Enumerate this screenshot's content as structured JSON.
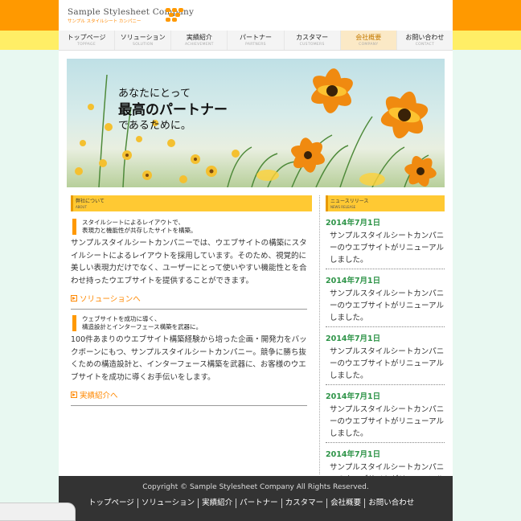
{
  "brand": {
    "title": "Sample Stylesheet Company",
    "subtitle": "サンプル スタイルシート カンパニー",
    "accent": "#ff9900",
    "news_green": "#2e9448",
    "footer_bg": "#333333"
  },
  "nav": [
    {
      "jp": "トップページ",
      "en": "TOPPAGE"
    },
    {
      "jp": "ソリューション",
      "en": "SOLUTION"
    },
    {
      "jp": "実績紹介",
      "en": "ACHIEVEMENT"
    },
    {
      "jp": "パートナー",
      "en": "PARTNERS"
    },
    {
      "jp": "カスタマー",
      "en": "CUSTOMERS"
    },
    {
      "jp": "会社概要",
      "en": "COMPANY"
    },
    {
      "jp": "お問い合わせ",
      "en": "CONTACT"
    }
  ],
  "hero": {
    "line1": "あなたにとって",
    "line2": "最高のパートナー",
    "line3": "であるために。"
  },
  "about": {
    "heading_jp": "弊社について",
    "heading_en": "ABOUT",
    "block1": {
      "lead1": "スタイルシートによるレイアウトで、",
      "lead2": "表現力と機能性が共存したサイトを構築。",
      "body": "サンプルスタイルシートカンパニーでは、ウエブサイトの構築にスタイルシートによるレイアウトを採用しています。そのため、視覚的に美しい表現力だけでなく、ユーザーにとって使いやすい機能性とを合わせ持ったウエブサイトを提供することができます。",
      "link": "ソリューションへ"
    },
    "block2": {
      "lead1": "ウェブサイトを成功に導く、",
      "lead2": "構造設計とインターフェース構築を武器に。",
      "body": "100件あまりのウエブサイト構築経験から培った企画・開発力をバックボーンにもつ、サンプルスタイルシートカンパニー。競争に勝ち抜くための構造設計と、インターフェース構築を武器に、お客様のウエブサイトを成功に導くお手伝いをします。",
      "link": "実績紹介へ"
    }
  },
  "news": {
    "heading_jp": "ニュースリリース",
    "heading_en": "NEWS RELEASE",
    "items": [
      {
        "date": "2014年7月1日",
        "text": "サンプルスタイルシートカンパニーのウエブサイトがリニューアルしました。"
      },
      {
        "date": "2014年7月1日",
        "text": "サンプルスタイルシートカンパニーのウエブサイトがリニューアルしました。"
      },
      {
        "date": "2014年7月1日",
        "text": "サンプルスタイルシートカンパニーのウエブサイトがリニューアルしました。"
      },
      {
        "date": "2014年7月1日",
        "text": "サンプルスタイルシートカンパニーのウエブサイトがリニューアルしました。"
      },
      {
        "date": "2014年7月1日",
        "text": "サンプルスタイルシートカンパニーのウエブサイトがリニューアルしました。"
      }
    ]
  },
  "footer": {
    "copyright": "Copyright © Sample Stylesheet Company All Rights Reserved.",
    "links": [
      "トップページ",
      "ソリューション",
      "実績紹介",
      "パートナー",
      "カスタマー",
      "会社概要",
      "お問い合わせ"
    ]
  }
}
